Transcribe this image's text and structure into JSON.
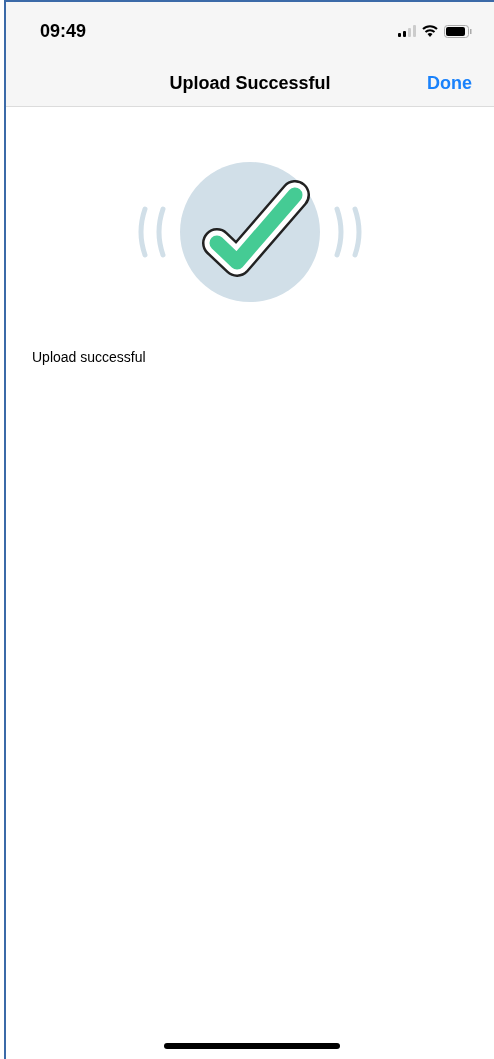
{
  "status_bar": {
    "time": "09:49"
  },
  "nav_bar": {
    "title": "Upload Successful",
    "action": "Done"
  },
  "message": "Upload successful"
}
